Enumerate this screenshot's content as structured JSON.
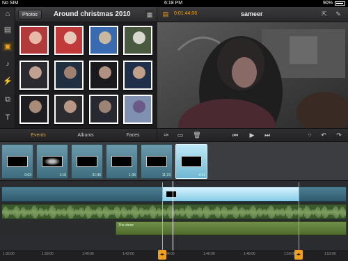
{
  "status_bar": {
    "carrier": "No SIM",
    "time": "6:18 PM",
    "battery": "90%"
  },
  "browser": {
    "photos_button": "Photos",
    "album_title": "Around christmas 2010",
    "tabs": [
      {
        "label": "Events",
        "active": true
      },
      {
        "label": "Albums",
        "active": false
      },
      {
        "label": "Faces",
        "active": false
      }
    ],
    "photos": [
      {
        "colors": [
          "#b23a3a",
          "#e8b8a8"
        ]
      },
      {
        "colors": [
          "#c03a3a",
          "#e8c8b8"
        ]
      },
      {
        "colors": [
          "#3a6ab0",
          "#c8b8a0"
        ]
      },
      {
        "colors": [
          "#4a5a40",
          "#d8d8d0"
        ]
      },
      {
        "colors": [
          "#2a2a30",
          "#c0a090"
        ]
      },
      {
        "colors": [
          "#203040",
          "#a08070"
        ]
      },
      {
        "colors": [
          "#1a1a1e",
          "#b09080"
        ]
      },
      {
        "colors": [
          "#20304a",
          "#c0a088"
        ]
      },
      {
        "colors": [
          "#1e1e22",
          "#a88c78"
        ]
      },
      {
        "colors": [
          "#2c2c30",
          "#b89884"
        ]
      },
      {
        "colors": [
          "#262a30",
          "#9c8474"
        ]
      },
      {
        "colors": [
          "#8090b0",
          "#6a5a8a"
        ]
      }
    ]
  },
  "viewer": {
    "timecode": "0:01:44.06",
    "project_name": "sameer"
  },
  "clips": [
    {
      "duration": "0:03"
    },
    {
      "duration": "1:16"
    },
    {
      "duration": "31:36"
    },
    {
      "duration": "1:36"
    },
    {
      "duration": "11:23"
    },
    {
      "duration": "4:21",
      "selected": true
    }
  ],
  "timeline": {
    "music_label": "The show",
    "ruler": [
      "1:36:00",
      "1:38:00",
      "1:40:00",
      "1:42:00",
      "1:44:00",
      "1:46:00",
      "1:48:00",
      "1:50:00",
      "1:52:00"
    ]
  },
  "colors": {
    "accent": "#f0a020",
    "clip_blue": "#6fb7d3",
    "audio_green": "#3b5a2e"
  }
}
